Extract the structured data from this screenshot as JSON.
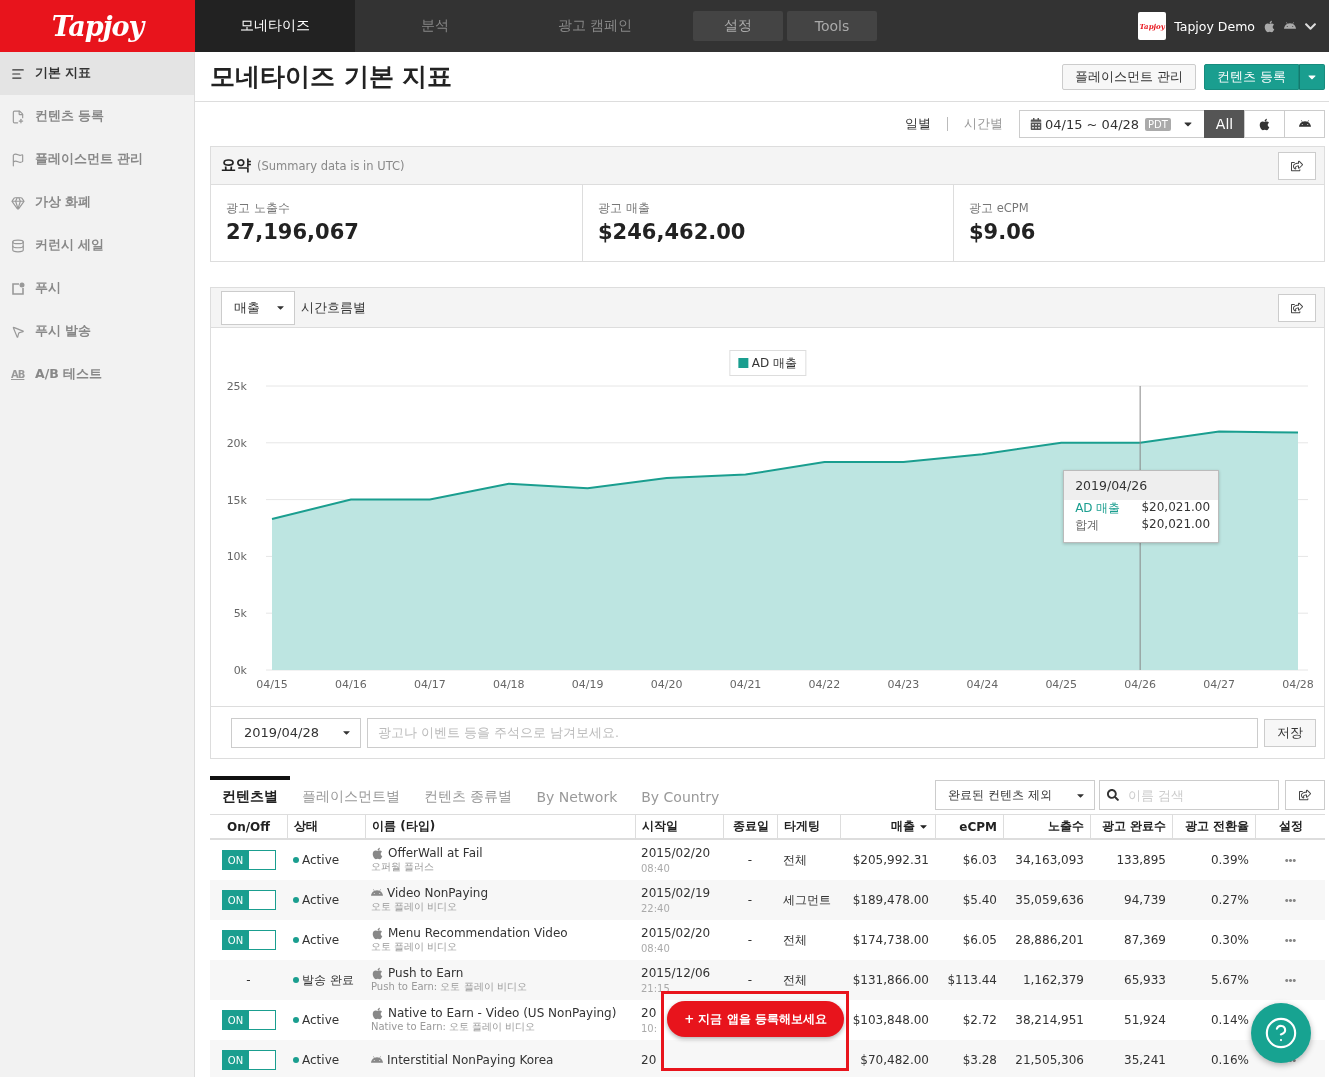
{
  "header": {
    "logo": "Tapjoy",
    "nav": [
      {
        "label": "모네타이즈",
        "kind": "tab",
        "selected": true
      },
      {
        "label": "분석",
        "kind": "tab",
        "selected": false
      },
      {
        "label": "광고 캠페인",
        "kind": "tab",
        "selected": false
      },
      {
        "label": "설정",
        "kind": "button",
        "selected": false
      },
      {
        "label": "Tools",
        "kind": "button",
        "selected": false
      }
    ],
    "account": {
      "avatar_logo": "Tapjoy",
      "name": "Tapjoy Demo"
    }
  },
  "sidebar": {
    "items": [
      {
        "label": "기본 지표",
        "selected": true
      },
      {
        "label": "컨텐츠 등록",
        "selected": false
      },
      {
        "label": "플레이스먼트 관리",
        "selected": false
      },
      {
        "label": "가상 화폐",
        "selected": false
      },
      {
        "label": "커런시 세일",
        "selected": false
      },
      {
        "label": "푸시",
        "selected": false
      },
      {
        "label": "푸시 발송",
        "selected": false
      },
      {
        "label": "A/B 테스트",
        "selected": false,
        "icon_label": "AB"
      }
    ]
  },
  "page": {
    "title": "모네타이즈 기본 지표",
    "actions": [
      {
        "label": "플레이스먼트 관리",
        "kind": "secondary"
      },
      {
        "label": "컨텐츠 등록",
        "kind": "primary"
      }
    ]
  },
  "toolbar": {
    "granularity": [
      {
        "label": "일별",
        "selected": true
      },
      {
        "label": "시간별",
        "selected": false
      }
    ],
    "date_range": "04/15 ~ 04/28",
    "timezone": "PDT",
    "platforms": [
      {
        "kind": "all",
        "label": "All",
        "selected": true
      },
      {
        "kind": "ios",
        "selected": false
      },
      {
        "kind": "android",
        "selected": false
      }
    ]
  },
  "summary": {
    "title": "요약",
    "note": "(Summary data is in UTC)",
    "metrics": [
      {
        "label": "광고 노출수",
        "value": "27,196,067"
      },
      {
        "label": "광고 매출",
        "value": "$246,462.00"
      },
      {
        "label": "광고 eCPM",
        "value": "$9.06"
      }
    ]
  },
  "chart_panel": {
    "metric": "매출",
    "view": "시간흐름별",
    "chart_data": {
      "type": "area",
      "categories": [
        "04/15",
        "04/16",
        "04/17",
        "04/18",
        "04/19",
        "04/20",
        "04/21",
        "04/22",
        "04/23",
        "04/24",
        "04/25",
        "04/26",
        "04/27",
        "04/28"
      ],
      "series": [
        {
          "name": "AD 매출",
          "color": "#1a9e8f",
          "values": [
            13300,
            15000,
            15000,
            16400,
            16000,
            16900,
            17200,
            18300,
            18300,
            19000,
            20000,
            20000,
            21000,
            20900
          ]
        }
      ],
      "grid": true,
      "ylim": [
        0,
        25000
      ],
      "yticks": [
        {
          "value": 0,
          "label": "0k"
        },
        {
          "value": 5000,
          "label": "5k"
        },
        {
          "value": 10000,
          "label": "10k"
        },
        {
          "value": 15000,
          "label": "15k"
        },
        {
          "value": 20000,
          "label": "20k"
        },
        {
          "value": 25000,
          "label": "25k"
        }
      ],
      "ref_lines": [
        {
          "axis": "x",
          "value": "04/26"
        }
      ]
    },
    "tooltip": {
      "date": "2019/04/26",
      "series_label": "AD 매출",
      "series_value": "$20,021.00",
      "total_label": "합계",
      "total_value": "$20,021.00"
    },
    "annotation": {
      "date": "2019/04/28",
      "placeholder": "광고나 이벤트 등을 주석으로 남겨보세요.",
      "save": "저장"
    }
  },
  "content": {
    "tabs": [
      {
        "label": "컨텐츠별",
        "selected": true
      },
      {
        "label": "플레이스먼트별",
        "selected": false
      },
      {
        "label": "컨텐츠 종류별",
        "selected": false
      },
      {
        "label": "By Network",
        "selected": false
      },
      {
        "label": "By Country",
        "selected": false
      }
    ],
    "filter": "완료된 컨텐츠 제외",
    "search_placeholder": "이름 검색",
    "table": {
      "columns": [
        {
          "label": "On/Off",
          "sorted": false
        },
        {
          "label": "상태",
          "sorted": false
        },
        {
          "label": "이름 (타입)",
          "sorted": false
        },
        {
          "label": "시작일",
          "sorted": false
        },
        {
          "label": "종료일",
          "sorted": false
        },
        {
          "label": "타게팅",
          "sorted": false
        },
        {
          "label": "매출",
          "sorted": true
        },
        {
          "label": "eCPM",
          "sorted": false
        },
        {
          "label": "노출수",
          "sorted": false
        },
        {
          "label": "광고 완료수",
          "sorted": false
        },
        {
          "label": "광고 전환율",
          "sorted": false
        },
        {
          "label": "설정",
          "sorted": false
        }
      ],
      "rows": [
        {
          "switch_label": "ON",
          "on": true,
          "status": "Active",
          "kind": "ios",
          "name": "OfferWall at Fail",
          "subtitle": "오퍼월 플러스",
          "start_date": "2015/02/20",
          "start_time": "08:40",
          "end_date": "-",
          "targeting": "전체",
          "revenue": "$205,992.31",
          "ecpm": "$6.03",
          "impressions": "34,163,093",
          "completions": "133,895",
          "conversion": "0.39%",
          "settings_menu": true
        },
        {
          "switch_label": "ON",
          "on": true,
          "status": "Active",
          "kind": "android",
          "name": "Video NonPaying",
          "subtitle": "오토 플레이 비디오",
          "start_date": "2015/02/19",
          "start_time": "22:40",
          "end_date": "-",
          "targeting": "세그먼트",
          "revenue": "$189,478.00",
          "ecpm": "$5.40",
          "impressions": "35,059,636",
          "completions": "94,739",
          "conversion": "0.27%",
          "settings_menu": true
        },
        {
          "switch_label": "ON",
          "on": true,
          "status": "Active",
          "kind": "ios",
          "name": "Menu Recommendation Video",
          "subtitle": "오토 플레이 비디오",
          "start_date": "2015/02/20",
          "start_time": "08:40",
          "end_date": "-",
          "targeting": "전체",
          "revenue": "$174,738.00",
          "ecpm": "$6.05",
          "impressions": "28,886,201",
          "completions": "87,369",
          "conversion": "0.30%",
          "settings_menu": true
        },
        {
          "onoff_text": "-",
          "status": "발송 완료",
          "kind": "ios",
          "name": "Push to Earn",
          "subtitle": "Push to Earn: 오토 플레이 비디오",
          "start_date": "2015/12/06",
          "start_time": "21:15",
          "end_date": "-",
          "targeting": "전체",
          "revenue": "$131,866.00",
          "ecpm": "$113.44",
          "impressions": "1,162,379",
          "completions": "65,933",
          "conversion": "5.67%",
          "settings_menu": true
        },
        {
          "switch_label": "ON",
          "on": true,
          "status": "Active",
          "kind": "ios",
          "name": "Native to Earn - Video (US NonPaying)",
          "subtitle": "Native to Earn: 오토 플레이 비디오",
          "start_date": "20",
          "start_time": "10:",
          "revenue": "$103,848.00",
          "ecpm": "$2.72",
          "impressions": "38,214,951",
          "completions": "51,924",
          "conversion": "0.14%",
          "settings_menu": false
        },
        {
          "switch_label": "ON",
          "on": true,
          "status": "Active",
          "kind": "android",
          "name": "Interstitial NonPaying Korea",
          "start_date": "20",
          "revenue": "$70,482.00",
          "ecpm": "$3.28",
          "impressions": "21,505,306",
          "completions": "35,241",
          "conversion": "0.16%",
          "settings_menu": true
        }
      ]
    }
  },
  "cta": {
    "label": "+ 지금 앱을 등록해보세요"
  }
}
